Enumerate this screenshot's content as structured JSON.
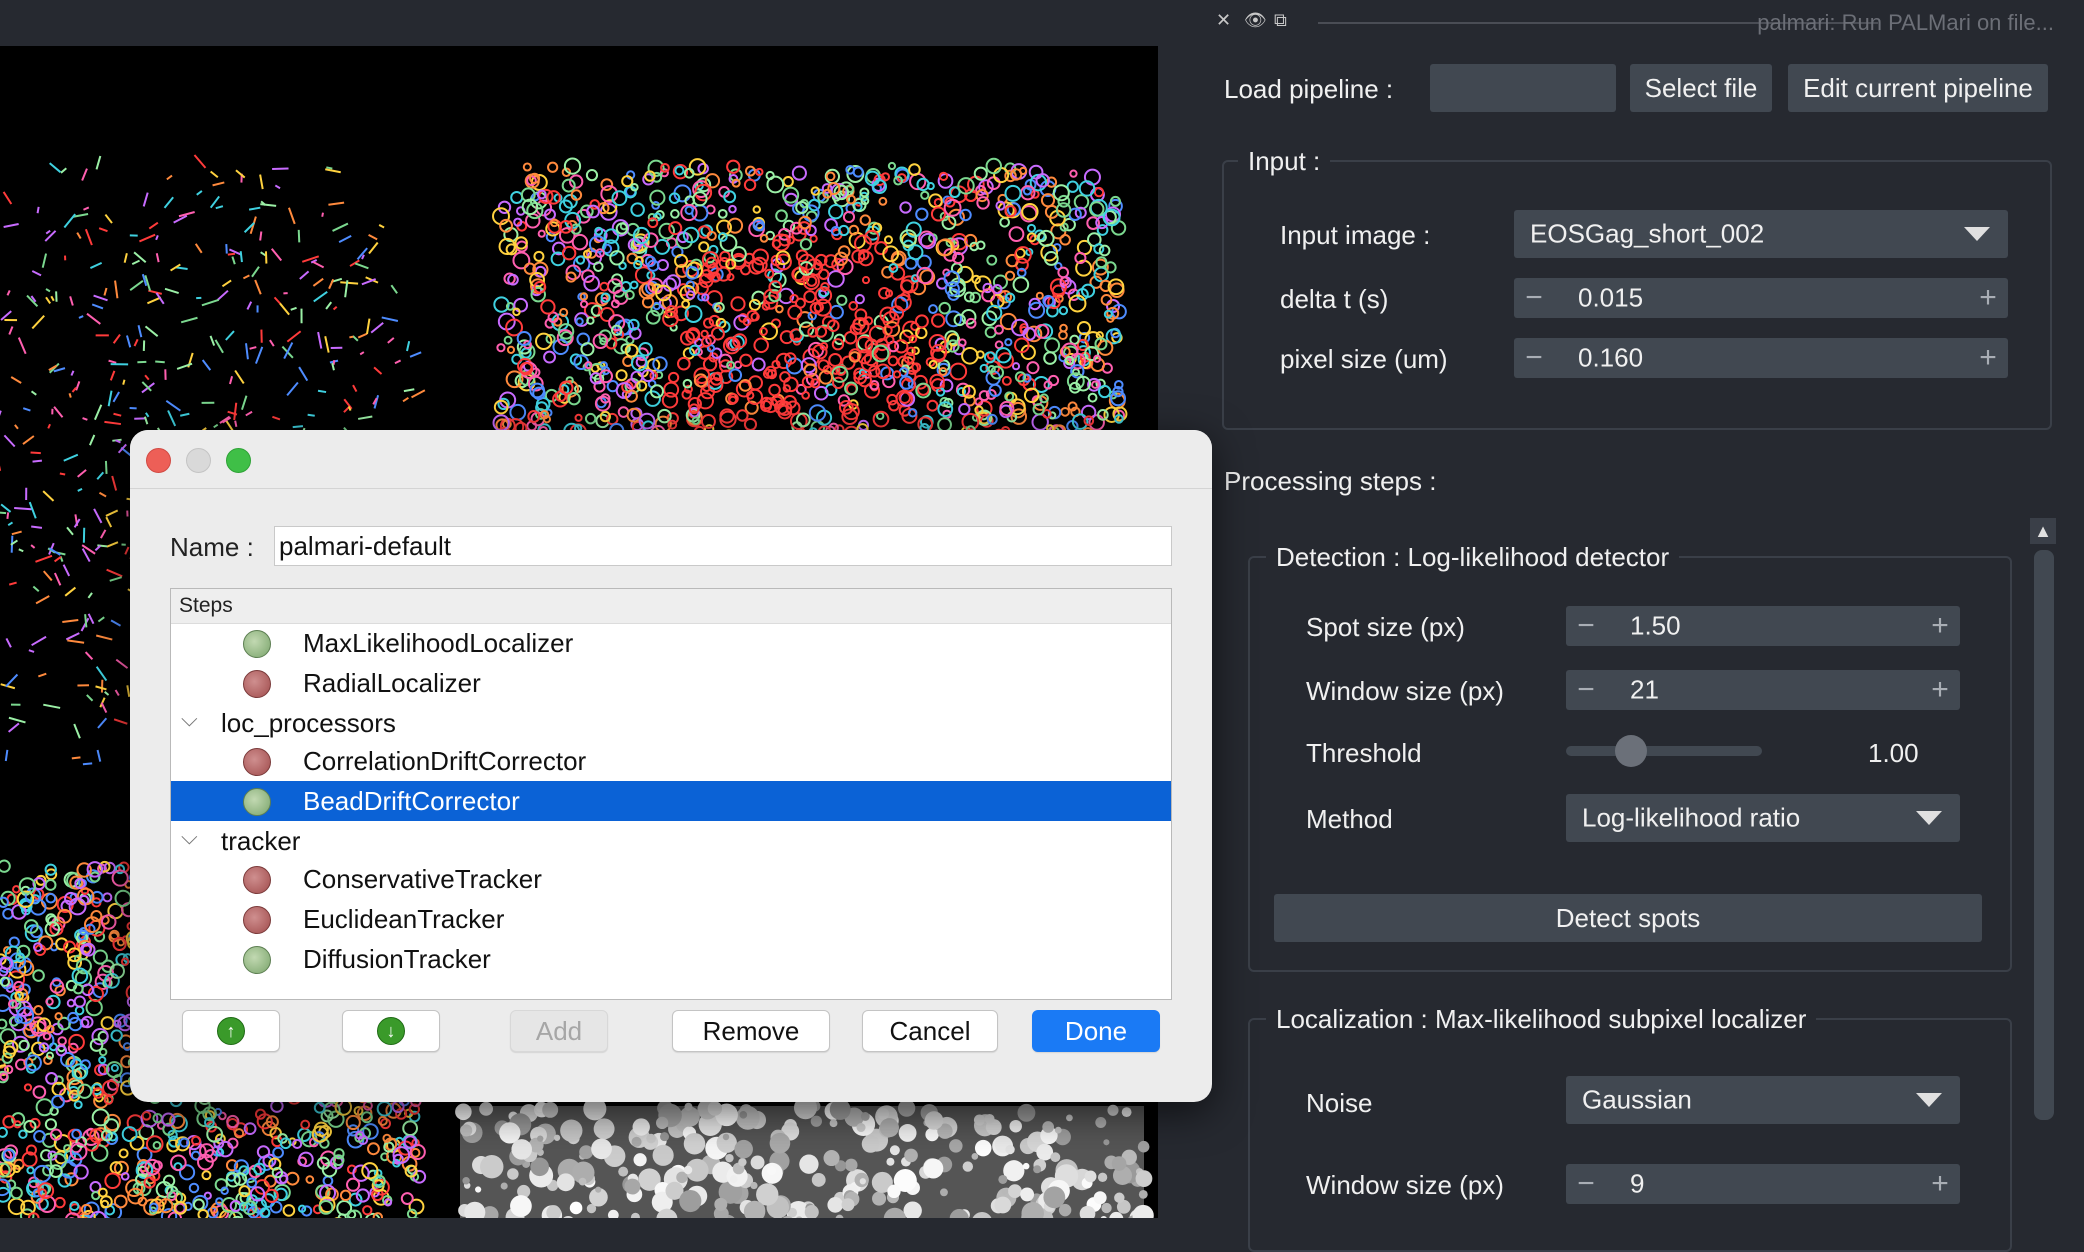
{
  "window": {
    "title": "palmari: Run PALMari on file...",
    "icons": [
      "close-icon",
      "eye-icon",
      "float-icon"
    ]
  },
  "load": {
    "label": "Load pipeline :",
    "select_file": "Select file",
    "edit_pipeline": "Edit current pipeline"
  },
  "input": {
    "title": "Input :",
    "image_label": "Input image :",
    "image_value": "EOSGag_short_002",
    "dt_label": "delta t (s)",
    "dt_value": "0.015",
    "px_label": "pixel size (um)",
    "px_value": "0.160"
  },
  "processing": {
    "title": "Processing steps :",
    "detection": {
      "title": "Detection : Log-likelihood detector",
      "spot_label": "Spot size (px)",
      "spot_value": "1.50",
      "window_label": "Window size (px)",
      "window_value": "21",
      "threshold_label": "Threshold",
      "threshold_value": "1.00",
      "threshold_level": 0.25,
      "method_label": "Method",
      "method_value": "Log-likelihood ratio",
      "detect_button": "Detect spots"
    },
    "localization": {
      "title": "Localization : Max-likelihood subpixel localizer",
      "noise_label": "Noise",
      "noise_value": "Gaussian",
      "window_label": "Window size (px)",
      "window_value": "9"
    }
  },
  "dialog": {
    "name_label": "Name :",
    "name_value": "palmari-default",
    "tree_header": "Steps",
    "rows": [
      {
        "type": "item",
        "label": "MaxLikelihoodLocalizer",
        "status": "green"
      },
      {
        "type": "item",
        "label": "RadialLocalizer",
        "status": "red"
      },
      {
        "type": "group",
        "label": "loc_processors"
      },
      {
        "type": "item",
        "label": "CorrelationDriftCorrector",
        "status": "red"
      },
      {
        "type": "item",
        "label": "BeadDriftCorrector",
        "status": "green",
        "selected": true
      },
      {
        "type": "group",
        "label": "tracker"
      },
      {
        "type": "item",
        "label": "ConservativeTracker",
        "status": "red"
      },
      {
        "type": "item",
        "label": "EuclideanTracker",
        "status": "red"
      },
      {
        "type": "item",
        "label": "DiffusionTracker",
        "status": "green"
      }
    ],
    "buttons": {
      "up": "",
      "down": "",
      "add": "Add",
      "remove": "Remove",
      "cancel": "Cancel",
      "done": "Done"
    }
  },
  "colors": {
    "panel_bg": "#262930",
    "widget_bg": "#414851",
    "selection": "#0b62d6",
    "primary_button": "#1a7af5"
  }
}
